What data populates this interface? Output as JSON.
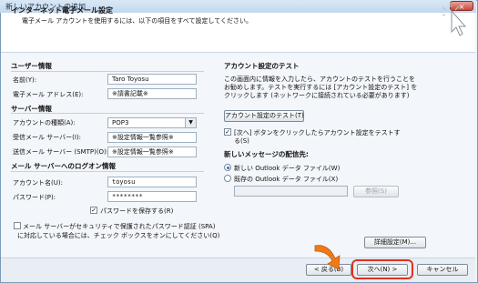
{
  "window": {
    "title": "新しいアカウントの追加",
    "close_glyph": "×"
  },
  "header": {
    "title": "インターネット電子メール設定",
    "subtitle": "電子メール アカウントを使用するには、以下の項目をすべて設定してください。",
    "cursor_icon": "pointer-click-icon"
  },
  "user_info": {
    "section": "ユーザー情報",
    "name_label": "名前(Y):",
    "name_value": "Taro Toyosu",
    "email_label": "電子メール アドレス(E):",
    "email_value": "※請書記載※"
  },
  "server_info": {
    "section": "サーバー情報",
    "account_type_label": "アカウントの種類(A):",
    "account_type_value": "POP3",
    "incoming_label": "受信メール サーバー(I):",
    "incoming_value": "※設定情報一覧参照※",
    "outgoing_label": "送信メール サーバー (SMTP)(O):",
    "outgoing_value": "※設定情報一覧参照※"
  },
  "logon_info": {
    "section": "メール サーバーへのログオン情報",
    "account_label": "アカウント名(U):",
    "account_value": "toyosu",
    "password_label": "パスワード(P):",
    "password_value": "********",
    "save_password": "パスワードを保存する(R)",
    "save_password_checked": true,
    "spa_text_1": "メール サーバーがセキュリティで保護されたパスワード認証 (SPA)",
    "spa_text_2": "に対応している場合には、チェック ボックスをオンにしてください(Q)",
    "spa_checked": false
  },
  "account_test": {
    "section": "アカウント設定のテスト",
    "desc_1": "この画面内に情報を入力したら、アカウントのテストを行うことを",
    "desc_2": "お勧めします。テストを実行するには [アカウント設定のテスト] を",
    "desc_3": "クリックします (ネットワークに接続されている必要があります)",
    "test_button": "アカウント設定のテスト(T)",
    "auto_test_1": "[次へ] ボタンをクリックしたらアカウント設定をテストす",
    "auto_test_2": "る(S)",
    "auto_test_checked": true
  },
  "delivery": {
    "section": "新しいメッセージの配信先:",
    "new_file": "新しい Outlook データ ファイル(W)",
    "existing_file": "既存の Outlook データ ファイル(X)",
    "existing_path": "",
    "browse_button": "参照(S)"
  },
  "more_settings_button": "詳細設定(M)...",
  "footer": {
    "back_button": "< 戻る(B)",
    "next_button": "次へ(N) >",
    "cancel_button": "キャンセル"
  },
  "colors": {
    "highlight": "#e0301e",
    "arrow_fill": "#f07a1a"
  }
}
